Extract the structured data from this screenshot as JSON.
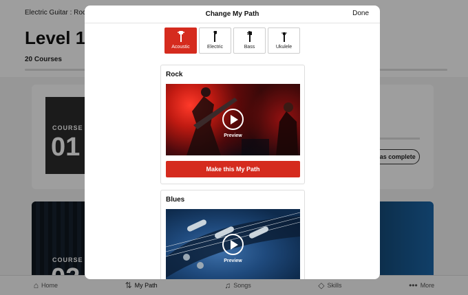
{
  "background": {
    "breadcrumb": "Electric Guitar : Rock",
    "level_title": "Level 1",
    "course_count": "20 Courses",
    "course_cards": [
      {
        "tag": "COURSE",
        "number": "01",
        "button_label": "Mark as complete"
      },
      {
        "tag": "COURSE",
        "number": "02"
      }
    ]
  },
  "bottom_nav": [
    {
      "label": "Home",
      "icon": "home-icon"
    },
    {
      "label": "My Path",
      "icon": "path-icon",
      "active": true
    },
    {
      "label": "Songs",
      "icon": "music-note-icon"
    },
    {
      "label": "Skills",
      "icon": "shield-icon"
    },
    {
      "label": "More",
      "icon": "more-dots-icon"
    }
  ],
  "modal": {
    "title": "Change My Path",
    "done_label": "Done",
    "instruments": [
      {
        "label": "Acoustic",
        "icon": "acoustic-guitar-icon",
        "selected": true
      },
      {
        "label": "Electric",
        "icon": "electric-guitar-icon",
        "selected": false
      },
      {
        "label": "Bass",
        "icon": "bass-guitar-icon",
        "selected": false
      },
      {
        "label": "Ukulele",
        "icon": "ukulele-icon",
        "selected": false
      }
    ],
    "paths": [
      {
        "title": "Rock",
        "preview_label": "Preview",
        "cta_label": "Make this My Path"
      },
      {
        "title": "Blues",
        "preview_label": "Preview"
      }
    ]
  },
  "colors": {
    "accent": "#d52b1e",
    "dim_overlay": "rgba(0,0,0,0.38)"
  }
}
